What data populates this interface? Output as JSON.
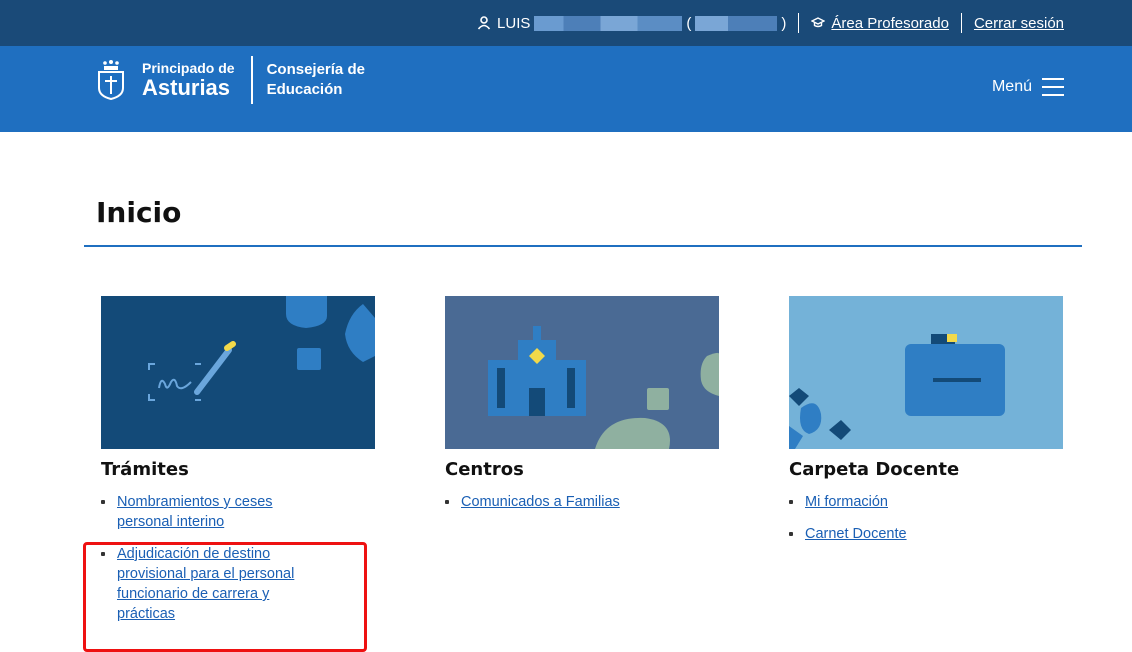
{
  "topbar": {
    "user_prefix": "LUIS",
    "paren_open": "(",
    "paren_close": ")",
    "area_profesorado": "Área Profesorado",
    "logout": "Cerrar sesión"
  },
  "header": {
    "brand_small": "Principado de",
    "brand_big": "Asturias",
    "dept_line1": "Consejería de",
    "dept_line2": "Educación",
    "menu_label": "Menú"
  },
  "main": {
    "title": "Inicio",
    "cards": [
      {
        "title": "Trámites",
        "links": [
          "Nombramientos y ceses personal interino",
          "Adjudicación de destino provisional para el personal funcionario de carrera y prácticas"
        ]
      },
      {
        "title": "Centros",
        "links": [
          "Comunicados a Familias"
        ]
      },
      {
        "title": "Carpeta Docente",
        "links": [
          "Mi formación",
          "Carnet Docente"
        ]
      }
    ]
  },
  "colors": {
    "topbar": "#1a4a78",
    "header": "#1f6fc0",
    "link": "#1a5fb4",
    "highlight": "#e11111"
  },
  "icons": [
    "user-icon",
    "graduation-cap-icon",
    "asturias-shield-icon",
    "hamburger-menu-icon"
  ]
}
